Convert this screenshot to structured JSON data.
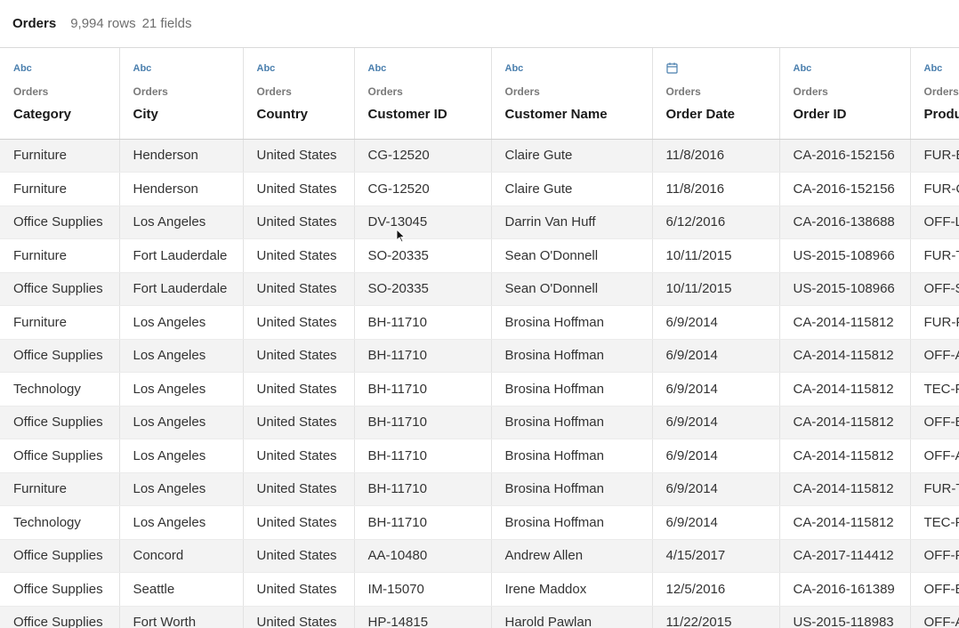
{
  "header": {
    "title": "Orders",
    "row_count": "9,994 rows",
    "field_count": "21 fields"
  },
  "columns": [
    {
      "type": "Abc",
      "icon": "text-type-icon",
      "source": "Orders",
      "name": "Category"
    },
    {
      "type": "Abc",
      "icon": "text-type-icon",
      "source": "Orders",
      "name": "City"
    },
    {
      "type": "Abc",
      "icon": "text-type-icon",
      "source": "Orders",
      "name": "Country"
    },
    {
      "type": "Abc",
      "icon": "text-type-icon",
      "source": "Orders",
      "name": "Customer ID"
    },
    {
      "type": "Abc",
      "icon": "text-type-icon",
      "source": "Orders",
      "name": "Customer Name"
    },
    {
      "type": "",
      "icon": "calendar-icon",
      "source": "Orders",
      "name": "Order Date"
    },
    {
      "type": "Abc",
      "icon": "text-type-icon",
      "source": "Orders",
      "name": "Order ID"
    },
    {
      "type": "Abc",
      "icon": "text-type-icon",
      "source": "Orders",
      "name": "Produ"
    }
  ],
  "rows": [
    [
      "Furniture",
      "Henderson",
      "United States",
      "CG-12520",
      "Claire Gute",
      "11/8/2016",
      "CA-2016-152156",
      "FUR-B"
    ],
    [
      "Furniture",
      "Henderson",
      "United States",
      "CG-12520",
      "Claire Gute",
      "11/8/2016",
      "CA-2016-152156",
      "FUR-C"
    ],
    [
      "Office Supplies",
      "Los Angeles",
      "United States",
      "DV-13045",
      "Darrin Van Huff",
      "6/12/2016",
      "CA-2016-138688",
      "OFF-L"
    ],
    [
      "Furniture",
      "Fort Lauderdale",
      "United States",
      "SO-20335",
      "Sean O'Donnell",
      "10/11/2015",
      "US-2015-108966",
      "FUR-T"
    ],
    [
      "Office Supplies",
      "Fort Lauderdale",
      "United States",
      "SO-20335",
      "Sean O'Donnell",
      "10/11/2015",
      "US-2015-108966",
      "OFF-S"
    ],
    [
      "Furniture",
      "Los Angeles",
      "United States",
      "BH-11710",
      "Brosina Hoffman",
      "6/9/2014",
      "CA-2014-115812",
      "FUR-F"
    ],
    [
      "Office Supplies",
      "Los Angeles",
      "United States",
      "BH-11710",
      "Brosina Hoffman",
      "6/9/2014",
      "CA-2014-115812",
      "OFF-A"
    ],
    [
      "Technology",
      "Los Angeles",
      "United States",
      "BH-11710",
      "Brosina Hoffman",
      "6/9/2014",
      "CA-2014-115812",
      "TEC-P"
    ],
    [
      "Office Supplies",
      "Los Angeles",
      "United States",
      "BH-11710",
      "Brosina Hoffman",
      "6/9/2014",
      "CA-2014-115812",
      "OFF-B"
    ],
    [
      "Office Supplies",
      "Los Angeles",
      "United States",
      "BH-11710",
      "Brosina Hoffman",
      "6/9/2014",
      "CA-2014-115812",
      "OFF-A"
    ],
    [
      "Furniture",
      "Los Angeles",
      "United States",
      "BH-11710",
      "Brosina Hoffman",
      "6/9/2014",
      "CA-2014-115812",
      "FUR-T"
    ],
    [
      "Technology",
      "Los Angeles",
      "United States",
      "BH-11710",
      "Brosina Hoffman",
      "6/9/2014",
      "CA-2014-115812",
      "TEC-P"
    ],
    [
      "Office Supplies",
      "Concord",
      "United States",
      "AA-10480",
      "Andrew Allen",
      "4/15/2017",
      "CA-2017-114412",
      "OFF-P"
    ],
    [
      "Office Supplies",
      "Seattle",
      "United States",
      "IM-15070",
      "Irene Maddox",
      "12/5/2016",
      "CA-2016-161389",
      "OFF-B"
    ],
    [
      "Office Supplies",
      "Fort Worth",
      "United States",
      "HP-14815",
      "Harold Pawlan",
      "11/22/2015",
      "US-2015-118983",
      "OFF-A"
    ]
  ],
  "colors": {
    "type_icon": "#4a7fae",
    "row_alt": "#f3f3f3",
    "border": "#e2e2e2"
  }
}
